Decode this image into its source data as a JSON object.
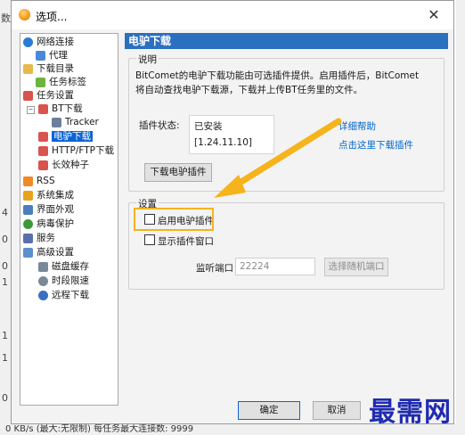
{
  "dialog": {
    "title": "选项..."
  },
  "tree": {
    "items": [
      {
        "label": "网络连接",
        "icon": "globe-icon",
        "color": "#2a7bd4"
      },
      {
        "label": "代理",
        "icon": "proxy-icon",
        "color": "#4a8ad8"
      },
      {
        "label": "下载目录",
        "icon": "folder-icon",
        "color": "#e8b84a"
      },
      {
        "label": "任务标签",
        "icon": "tag-icon",
        "color": "#6cb33f"
      },
      {
        "label": "任务设置",
        "icon": "task-icon",
        "color": "#d9534f"
      },
      {
        "label": "BT下载",
        "icon": "bt-icon",
        "color": "#d9534f"
      },
      {
        "label": "Tracker",
        "icon": "tracker-icon",
        "color": "#6b7f9a"
      },
      {
        "label": "电驴下载",
        "icon": "emule-icon",
        "color": "#d9534f"
      },
      {
        "label": "HTTP/FTP下载",
        "icon": "http-icon",
        "color": "#d9534f"
      },
      {
        "label": "长效种子",
        "icon": "seed-icon",
        "color": "#d9534f"
      },
      {
        "label": "RSS",
        "icon": "rss-icon",
        "color": "#f08a24"
      },
      {
        "label": "系统集成",
        "icon": "integration-icon",
        "color": "#e8a21c"
      },
      {
        "label": "界面外观",
        "icon": "appearance-icon",
        "color": "#4a7fc0"
      },
      {
        "label": "病毒保护",
        "icon": "shield-icon",
        "color": "#3a9a3a"
      },
      {
        "label": "服务",
        "icon": "service-icon",
        "color": "#5a6fae"
      },
      {
        "label": "高级设置",
        "icon": "advanced-icon",
        "color": "#5a8fd0"
      },
      {
        "label": "磁盘缓存",
        "icon": "disk-icon",
        "color": "#7a8898"
      },
      {
        "label": "时段限速",
        "icon": "clock-icon",
        "color": "#7a8898"
      },
      {
        "label": "远程下载",
        "icon": "remote-icon",
        "color": "#3a6fbf"
      }
    ]
  },
  "panel": {
    "header": "电驴下载",
    "description_title": "说明",
    "description": "BitComet的电驴下载功能由可选插件提供。启用插件后，BitComet将自动查找电驴下载源，下载并上传BT任务里的文件。",
    "plugin_status_label": "插件状态:",
    "plugin_status_value": "已安装",
    "plugin_version": "[1.24.11.10]",
    "help_link": "详细帮助",
    "download_link": "点击这里下载插件",
    "download_button": "下载电驴插件",
    "settings_title": "设置",
    "enable_checkbox": "启用电驴插件",
    "enable_checked": false,
    "show_window_checkbox": "显示插件窗口",
    "show_window_checked": false,
    "port_label": "监听端口",
    "port_value": "22224",
    "random_port_button": "选择随机端口"
  },
  "buttons": {
    "ok": "确定",
    "cancel": "取消"
  },
  "background": {
    "status_text": "0 KB/s (最大:无限制)   每任务最大连接数: 9999"
  },
  "watermark": "最需网",
  "colors": {
    "accent": "#2b6fbf",
    "highlight": "#f5b31c",
    "arrow": "#f5b31c",
    "link": "#0066cc"
  }
}
